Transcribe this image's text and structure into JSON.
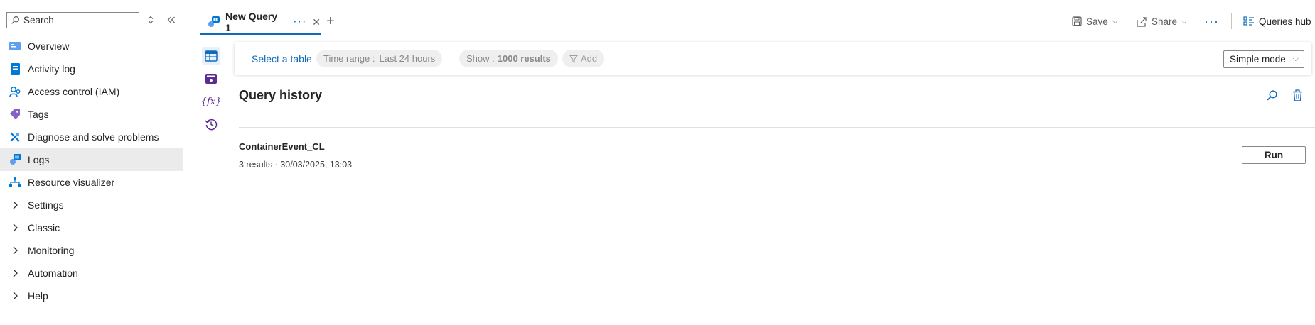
{
  "sidebar": {
    "search_placeholder": "Search",
    "items": [
      {
        "label": "Overview",
        "icon": "overview-icon"
      },
      {
        "label": "Activity log",
        "icon": "activity-log-icon"
      },
      {
        "label": "Access control (IAM)",
        "icon": "iam-icon"
      },
      {
        "label": "Tags",
        "icon": "tag-icon"
      },
      {
        "label": "Diagnose and solve problems",
        "icon": "wrench-icon"
      },
      {
        "label": "Logs",
        "icon": "logs-icon",
        "active": true
      },
      {
        "label": "Resource visualizer",
        "icon": "resource-visualizer-icon"
      },
      {
        "label": "Settings",
        "icon": "chevron-right-icon"
      },
      {
        "label": "Classic",
        "icon": "chevron-right-icon"
      },
      {
        "label": "Monitoring",
        "icon": "chevron-right-icon"
      },
      {
        "label": "Automation",
        "icon": "chevron-right-icon"
      },
      {
        "label": "Help",
        "icon": "chevron-right-icon"
      }
    ]
  },
  "tabs": [
    {
      "title": "New Query 1",
      "active": true
    }
  ],
  "toolbar": {
    "save_label": "Save",
    "share_label": "Share",
    "queries_hub_label": "Queries hub"
  },
  "query_bar": {
    "select_table": "Select a table",
    "time_range_label": "Time range :",
    "time_range_value": "Last 24 hours",
    "show_label": "Show :",
    "show_value": "1000 results",
    "add_label": "Add",
    "mode": "Simple mode"
  },
  "query_history": {
    "title": "Query history",
    "entries": [
      {
        "name": "ContainerEvent_CL",
        "meta": "3 results · 30/03/2025, 13:03",
        "action": "Run"
      }
    ]
  },
  "colors": {
    "accent": "#0f6cbd",
    "purple": "#5c2d91",
    "active_bg": "#ebebeb"
  }
}
